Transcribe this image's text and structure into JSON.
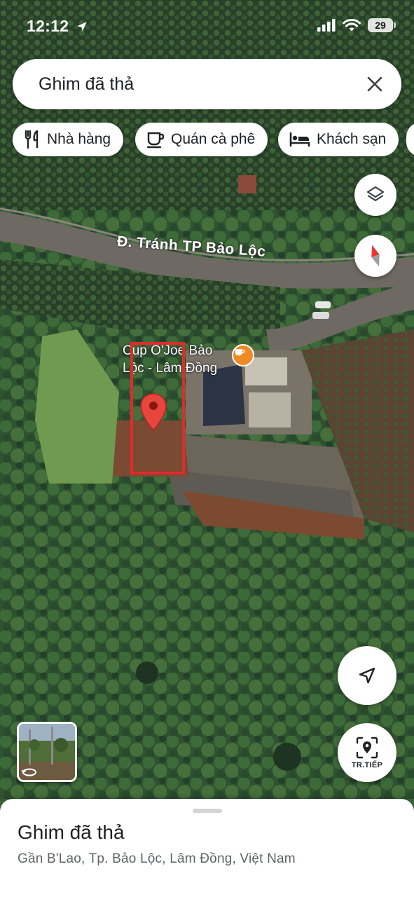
{
  "status_bar": {
    "time": "12:12",
    "battery_level": "29",
    "icons": [
      "location-arrow-icon",
      "cellular-signal-icon",
      "wifi-icon",
      "battery-icon"
    ]
  },
  "search": {
    "query": "Ghim đã thả",
    "clear_icon": "close-icon"
  },
  "chips": [
    {
      "label": "Nhà hàng",
      "icon": "restaurant-icon"
    },
    {
      "label": "Quán cà phê",
      "icon": "coffee-icon"
    },
    {
      "label": "Khách sạn",
      "icon": "hotel-icon"
    }
  ],
  "map": {
    "road_label": "Đ. Tránh TP Bảo Lộc",
    "poi": {
      "name_line1": "Cup O'Joe Bảo",
      "name_line2": "Lộc - Lâm Đồng",
      "icon": "coffee-icon",
      "icon_color": "#f08a24"
    },
    "pin_color": "#e8453c",
    "highlight_color": "#e02b2b"
  },
  "controls": {
    "layers_icon": "layers-icon",
    "compass_icon": "compass-icon",
    "locate_icon": "navigation-arrow-icon",
    "live_view_icon": "live-view-pin-icon",
    "live_view_label": "TR.TIẾP",
    "street_view_icon": "rotate-360-icon"
  },
  "place_sheet": {
    "title": "Ghim đã thả",
    "address": "Gần B'Lao, Tp. Bảo Lộc, Lâm Đồng, Việt Nam"
  }
}
